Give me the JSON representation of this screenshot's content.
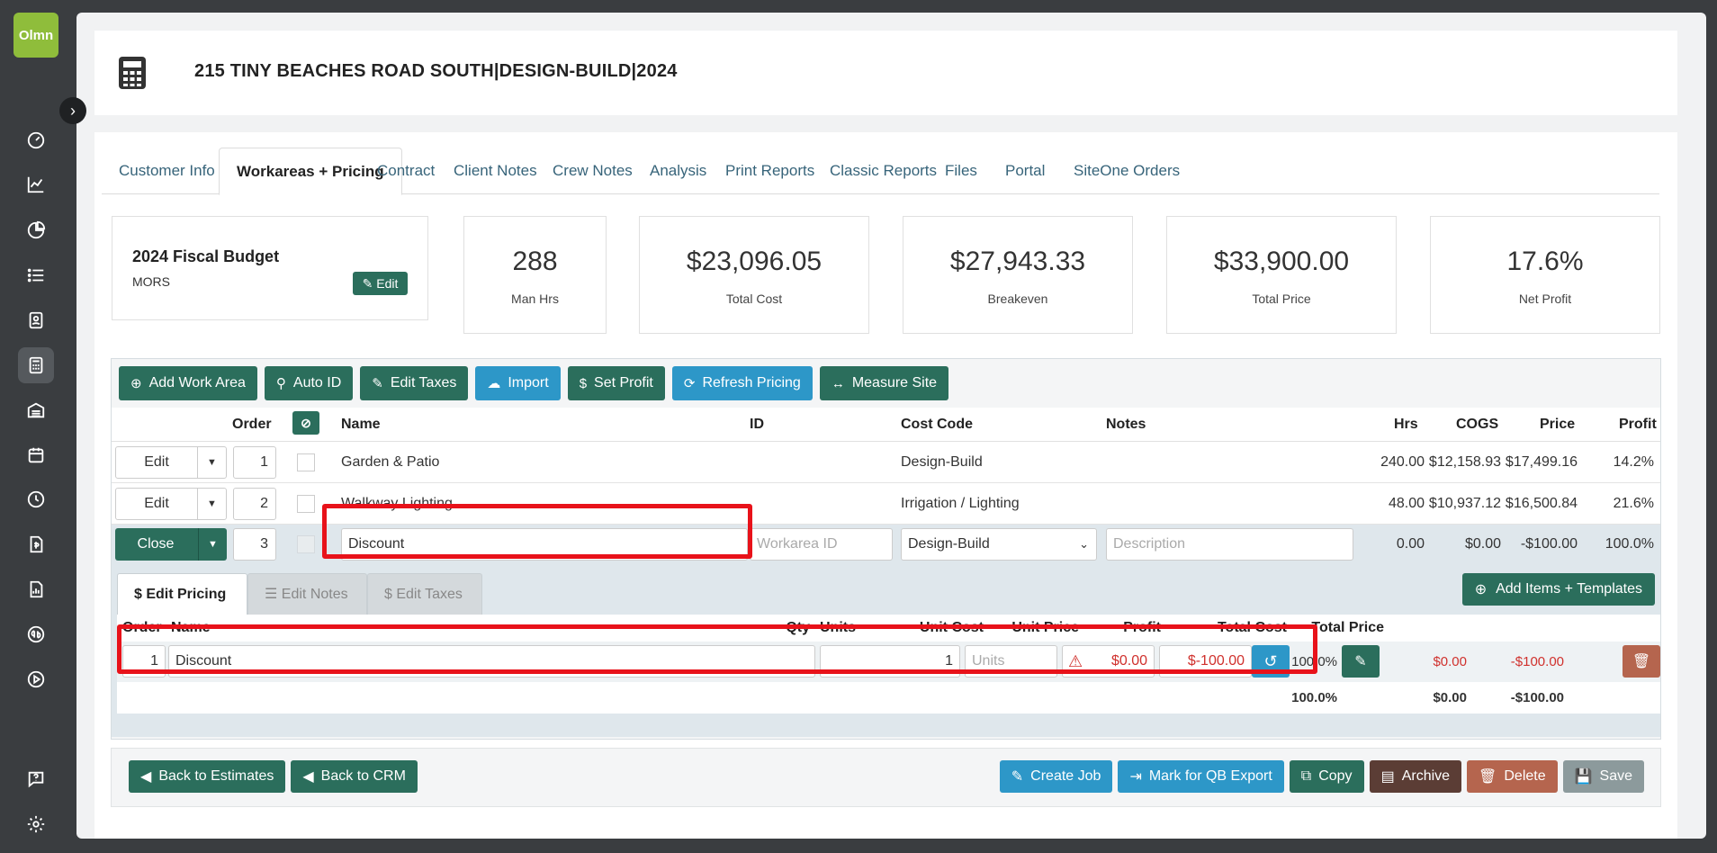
{
  "app": {
    "logo_text": "Olmn"
  },
  "sidebar": {
    "items": [
      {
        "icon": "dashboard-icon"
      },
      {
        "icon": "chart-line-icon"
      },
      {
        "icon": "pie-chart-icon"
      },
      {
        "icon": "list-icon"
      },
      {
        "icon": "contact-card-icon"
      },
      {
        "icon": "calculator-icon",
        "active": true
      },
      {
        "icon": "warehouse-icon"
      },
      {
        "icon": "calendar-icon"
      },
      {
        "icon": "clock-icon"
      },
      {
        "icon": "invoice-icon"
      },
      {
        "icon": "report-icon"
      },
      {
        "icon": "quickbooks-icon"
      },
      {
        "icon": "play-icon"
      }
    ],
    "bottom": [
      {
        "icon": "help-chat-icon"
      },
      {
        "icon": "settings-icon"
      }
    ]
  },
  "header": {
    "title": "215 TINY BEACHES ROAD SOUTH|DESIGN-BUILD|2024"
  },
  "tabs": [
    {
      "label": "Customer Info"
    },
    {
      "label": "Workareas + Pricing",
      "active": true
    },
    {
      "label": "Contract"
    },
    {
      "label": "Client Notes"
    },
    {
      "label": "Crew Notes"
    },
    {
      "label": "Analysis"
    },
    {
      "label": "Print Reports"
    },
    {
      "label": "Classic Reports"
    },
    {
      "label": "Files"
    },
    {
      "label": "Portal"
    },
    {
      "label": "SiteOne Orders"
    }
  ],
  "budget": {
    "title": "2024 Fiscal Budget",
    "subtitle": "MORS",
    "edit_label": "Edit"
  },
  "stats": [
    {
      "value": "288",
      "label": "Man Hrs"
    },
    {
      "value": "$23,096.05",
      "label": "Total Cost"
    },
    {
      "value": "$27,943.33",
      "label": "Breakeven"
    },
    {
      "value": "$33,900.00",
      "label": "Total Price"
    },
    {
      "value": "17.6%",
      "label": "Net Profit"
    }
  ],
  "toolbar": {
    "add_work_area": "Add Work Area",
    "auto_id": "Auto ID",
    "edit_taxes": "Edit Taxes",
    "import": "Import",
    "set_profit": "Set Profit",
    "refresh_pricing": "Refresh Pricing",
    "measure_site": "Measure Site"
  },
  "grid": {
    "headers": {
      "order": "Order",
      "name": "Name",
      "id": "ID",
      "cost_code": "Cost Code",
      "notes": "Notes",
      "hrs": "Hrs",
      "cogs": "COGS",
      "price": "Price",
      "profit": "Profit"
    },
    "rows": [
      {
        "action": "Edit",
        "order": "1",
        "name": "Garden & Patio",
        "cost_code": "Design-Build",
        "hrs": "240.00",
        "cogs": "$12,158.93",
        "price": "$17,499.16",
        "profit": "14.2%"
      },
      {
        "action": "Edit",
        "order": "2",
        "name": "Walkway Lighting",
        "cost_code": "Irrigation / Lighting",
        "hrs": "48.00",
        "cogs": "$10,937.12",
        "price": "$16,500.84",
        "profit": "21.6%"
      }
    ],
    "active_row": {
      "action": "Close",
      "order": "3",
      "name": "Discount",
      "id_placeholder": "Workarea ID",
      "cost_code": "Design-Build",
      "notes_placeholder": "Description",
      "hrs": "0.00",
      "cogs": "$0.00",
      "price": "-$100.00",
      "profit": "100.0%"
    }
  },
  "subtabs": [
    {
      "label": "Edit Pricing",
      "active": true
    },
    {
      "label": "Edit Notes"
    },
    {
      "label": "Edit Taxes"
    }
  ],
  "add_items_label": "Add Items + Templates",
  "items": {
    "headers": {
      "order": "Order",
      "name": "Name",
      "qty": "Qty",
      "units": "Units",
      "unit_cost": "Unit Cost",
      "unit_price": "Unit Price",
      "profit": "Profit",
      "total_cost": "Total Cost",
      "total_price": "Total Price"
    },
    "row": {
      "order": "1",
      "name": "Discount",
      "qty": "1",
      "units_placeholder": "Units",
      "unit_cost": "$0.00",
      "unit_price": "$-100.00",
      "profit": "100.0%",
      "total_cost": "$0.00",
      "total_price": "-$100.00"
    },
    "totals": {
      "profit": "100.0%",
      "total_cost": "$0.00",
      "total_price": "-$100.00"
    }
  },
  "footer": {
    "back_estimates": "Back to Estimates",
    "back_crm": "Back to CRM",
    "create_job": "Create Job",
    "mark_qb": "Mark for QB Export",
    "copy": "Copy",
    "archive": "Archive",
    "delete": "Delete",
    "save": "Save"
  },
  "colors": {
    "primary_green": "#2b6e5c",
    "info_blue": "#2d97c8",
    "highlight_red": "#e8121a",
    "danger_red": "#d0312d"
  }
}
